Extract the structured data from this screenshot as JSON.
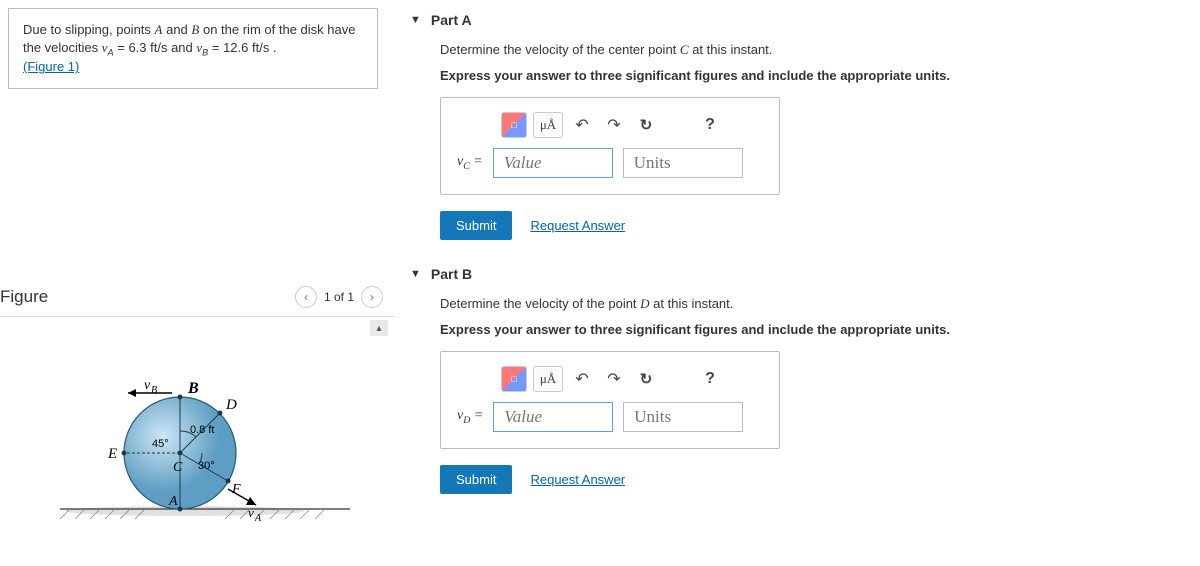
{
  "problem": {
    "text_prefix": "Due to slipping, points ",
    "ptA": "A",
    "and": " and ",
    "ptB": "B",
    "text_mid": " on the rim of the disk have the velocities ",
    "vA_sym": "v",
    "vA_sub": "A",
    "vA_eq": " = 6.3 ft/s",
    "and2": " and ",
    "vB_sym": "v",
    "vB_sub": "B",
    "vB_eq": " = 12.6 ft/s .",
    "fig_link": "(Figure 1)"
  },
  "figure": {
    "title": "Figure",
    "counter": "1 of 1",
    "labels": {
      "B": "B",
      "D": "D",
      "E": "E",
      "C": "C",
      "A": "A",
      "F": "F",
      "vB": "vB",
      "vA": "vA",
      "r": "0.8 ft",
      "ang45": "45°",
      "ang30": "30°"
    }
  },
  "partA": {
    "title": "Part A",
    "question_prefix": "Determine the velocity of the center point ",
    "pointC": "C",
    "question_suffix": " at this instant.",
    "instr": "Express your answer to three significant figures and include the appropriate units.",
    "lhs_v": "v",
    "lhs_sub": "C",
    "lhs_eq": " =",
    "value_ph": "Value",
    "units_ph": "Units",
    "submit": "Submit",
    "request": "Request Answer",
    "tool_ua": "μÅ",
    "tool_q": "?"
  },
  "partB": {
    "title": "Part B",
    "question_prefix": "Determine the velocity of the point ",
    "pointD": "D",
    "question_suffix": " at this instant.",
    "instr": "Express your answer to three significant figures and include the appropriate units.",
    "lhs_v": "v",
    "lhs_sub": "D",
    "lhs_eq": " =",
    "value_ph": "Value",
    "units_ph": "Units",
    "submit": "Submit",
    "request": "Request Answer",
    "tool_ua": "μÅ",
    "tool_q": "?"
  }
}
